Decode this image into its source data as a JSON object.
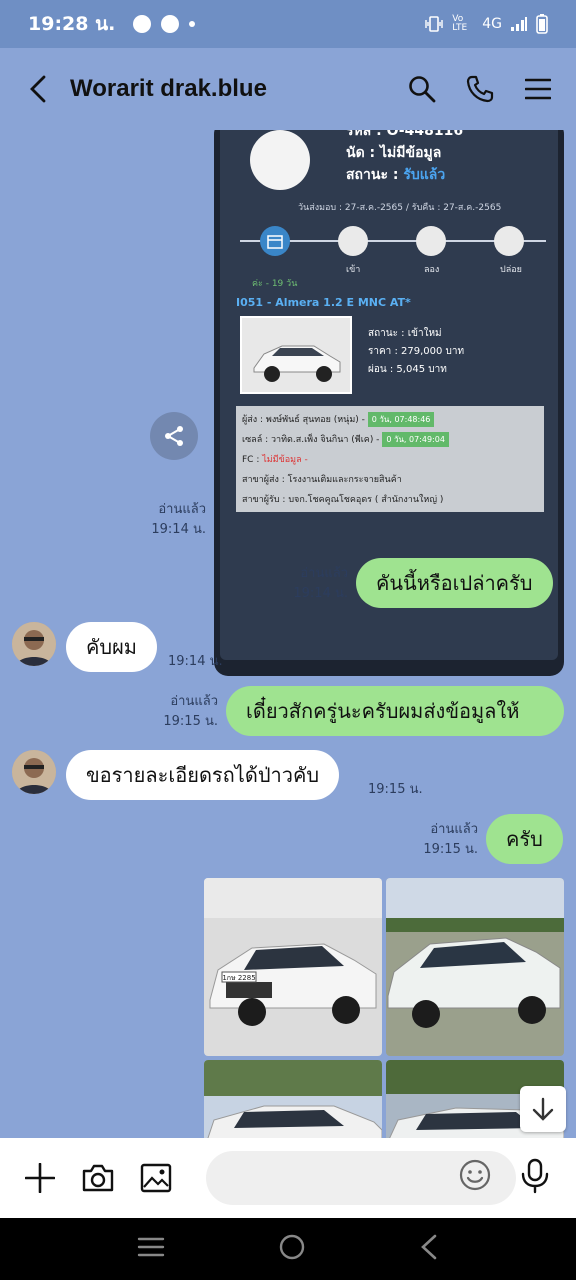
{
  "status_bar": {
    "time": "19:28 น.",
    "network": "4G",
    "volte": "Vo LTE"
  },
  "header": {
    "title": "Worarit drak.blue"
  },
  "card": {
    "code": "รหัส : O-448116",
    "appointment": "นัด : ไม่มีข้อมูล",
    "status_label": "สถานะ : ",
    "status_value": "รับแล้ว",
    "dates": "วันส่งมอบ : 27-ส.ค.-2565 / รับคืน : 27-ส.ค.-2565",
    "timeline_labels": [
      "เข้า",
      "ลอง",
      "ปล่อย"
    ],
    "days": "ค่ะ - 19 วัน",
    "model": "I051 - Almera 1.2 E MNC AT*",
    "detail_status": "สถานะ : เข้าใหม่",
    "detail_price": "ราคา : 279,000 บาท",
    "detail_installment": "ผ่อน : 5,045 บาท",
    "info": {
      "sender_label": "ผู้ส่ง : พงษ์พันธ์ สุนทอย (หนุ่ม) -",
      "sender_time": "0 วัน, 07:48:46",
      "sales_label": "เซลล์ : วาทิด.ส.เพ็ง จินกินา (พีเค) -",
      "sales_time": "0 วัน, 07:49:04",
      "fc_label": "FC : ",
      "fc_value": "ไม่มีข้อมูล -",
      "branch_send": "สาขาผู้ส่ง : โรงงานเติมและกระจายสินค้า",
      "branch_receive": "สาขาผู้รับ : บจก.โชคคูณโชคอุดร ( สำนักงานใหญ่ )"
    }
  },
  "messages": [
    {
      "read": "อ่านแล้ว",
      "time": "19:14 น."
    },
    {
      "text": "คันนี้หรือเปล่าครับ",
      "read": "อ่านแล้ว",
      "time": "19:14 น."
    },
    {
      "text": "คับผม",
      "time": "19:14 น."
    },
    {
      "text": "เดี๋ยวสักครู่นะครับผมส่งข้อมูลให้",
      "read": "อ่านแล้ว",
      "time": "19:15 น."
    },
    {
      "text": "ขอรายละเอียดรถได้ป่าวคับ",
      "time": "19:15 น."
    },
    {
      "text": "ครับ",
      "read": "อ่านแล้ว",
      "time": "19:15 น."
    }
  ],
  "photo_plate": "1กษ 2285",
  "input": {
    "placeholder": ""
  },
  "colors": {
    "chat_bg": "#8aa4d6",
    "bubble_out": "#9fe390",
    "bubble_in": "#ffffff",
    "card_bg": "#2f3b4f"
  }
}
